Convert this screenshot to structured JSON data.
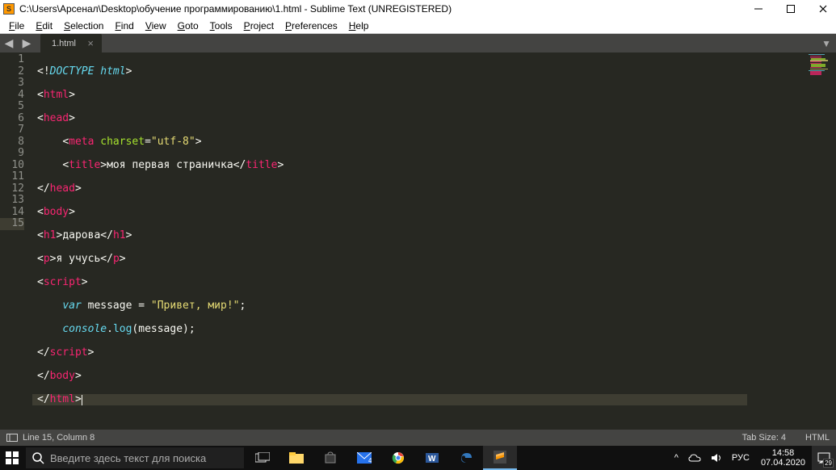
{
  "window": {
    "title": "C:\\Users\\Арсенал\\Desktop\\обучение программированию\\1.html - Sublime Text (UNREGISTERED)"
  },
  "menu": [
    "File",
    "Edit",
    "Selection",
    "Find",
    "View",
    "Goto",
    "Tools",
    "Project",
    "Preferences",
    "Help"
  ],
  "tab": {
    "name": "1.html"
  },
  "gutter": [
    "1",
    "2",
    "3",
    "4",
    "5",
    "6",
    "7",
    "8",
    "9",
    "10",
    "11",
    "12",
    "13",
    "14",
    "15"
  ],
  "code": {
    "l1": {
      "a": "<!",
      "b": "DOCTYPE html",
      "c": ">"
    },
    "l2": {
      "a": "<",
      "b": "html",
      "c": ">"
    },
    "l3": {
      "a": "<",
      "b": "head",
      "c": ">"
    },
    "l4": {
      "indent": "    ",
      "a": "<",
      "b": "meta",
      "sp": " ",
      "attr": "charset",
      "eq": "=",
      "str": "\"utf-8\"",
      "c": ">"
    },
    "l5": {
      "indent": "    ",
      "a": "<",
      "b": "title",
      "c": ">",
      "txt": "моя первая страничка",
      "d": "</",
      "e": "title",
      "f": ">"
    },
    "l6": {
      "a": "</",
      "b": "head",
      "c": ">"
    },
    "l7": {
      "a": "<",
      "b": "body",
      "c": ">"
    },
    "l8": {
      "a": "<",
      "b": "h1",
      "c": ">",
      "txt": "дарова",
      "d": "</",
      "e": "h1",
      "f": ">"
    },
    "l9": {
      "a": "<",
      "b": "p",
      "c": ">",
      "txt": "я учусь",
      "d": "</",
      "e": "p",
      "f": ">"
    },
    "l10": {
      "a": "<",
      "b": "script",
      "c": ">"
    },
    "l11": {
      "indent": "    ",
      "kw": "var",
      "sp": " ",
      "id": "message",
      "rest": " = ",
      "str": "\"Привет, мир!\"",
      "semi": ";"
    },
    "l12": {
      "indent": "    ",
      "obj": "console",
      "dot": ".",
      "fn": "log",
      "paren": "(message);"
    },
    "l13": {
      "a": "</",
      "b": "script",
      "c": ">"
    },
    "l14": {
      "a": "</",
      "b": "body",
      "c": ">"
    },
    "l15": {
      "a": "</",
      "b": "html",
      "c": ">"
    }
  },
  "status": {
    "pos": "Line 15, Column 8",
    "tabsize": "Tab Size: 4",
    "lang": "HTML"
  },
  "search_placeholder": "Введите здесь текст для поиска",
  "tray": {
    "chevron": "^",
    "lang": "РУС",
    "time": "14:58",
    "date": "07.04.2020",
    "notif": "29"
  }
}
